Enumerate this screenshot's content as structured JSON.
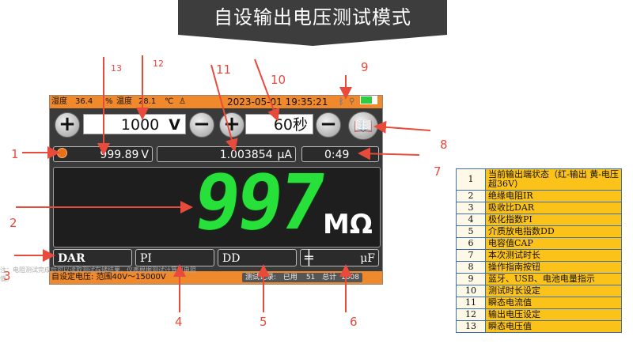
{
  "banner": {
    "title": "自设输出电压测试模式"
  },
  "status": {
    "humidity_label": "湿度",
    "humidity_value": "36.4",
    "humidity_unit": "%",
    "temp_label": "温度",
    "temp_value": "28.1",
    "temp_unit": "℃",
    "datetime": "2023-05-01 19:35:21"
  },
  "voltage_setting": {
    "value": "1000",
    "unit": "V",
    "plus": "+",
    "minus": "−"
  },
  "time_setting": {
    "value": "60秒",
    "plus": "+",
    "minus": "−"
  },
  "readouts": {
    "instant_voltage": "999.89",
    "voltage_unit": "V",
    "instant_current": "1.003854",
    "current_unit": "μA",
    "elapsed": "0:49"
  },
  "main": {
    "value": "997",
    "unit": "MΩ"
  },
  "params": {
    "dar": "DAR",
    "pi": "PI",
    "dd": "DD",
    "cap_symbol": "╪",
    "cap_unit": "μF"
  },
  "bottom": {
    "mode_text": "自设定电压: 范围40V～15000V",
    "record_label": "测试记录:",
    "used_label": "已用",
    "used_value": "51",
    "total_label": "总计",
    "total_value": "1008"
  },
  "callouts": [
    "1",
    "2",
    "3",
    "4",
    "5",
    "6",
    "7",
    "8",
    "9",
    "10",
    "11",
    "12",
    "13"
  ],
  "legend": [
    {
      "num": "1",
      "text": "当前输出端状态（红-输出 黄-电压超36V）"
    },
    {
      "num": "2",
      "text": "绝缘电阻IR"
    },
    {
      "num": "3",
      "text": "吸收比DAR"
    },
    {
      "num": "4",
      "text": "极化指数PI"
    },
    {
      "num": "5",
      "text": "介质放电指数DD"
    },
    {
      "num": "6",
      "text": "电容值CAP"
    },
    {
      "num": "7",
      "text": "本次测试时长"
    },
    {
      "num": "8",
      "text": "操作指南按钮"
    },
    {
      "num": "9",
      "text": "蓝牙、USB、电池电量指示"
    },
    {
      "num": "10",
      "text": "测试时长设定"
    },
    {
      "num": "11",
      "text": "瞬态电流值"
    },
    {
      "num": "12",
      "text": "输出电压设定"
    },
    {
      "num": "13",
      "text": "瞬态电压值"
    }
  ],
  "note": "注：电阻测试完成后可以读取测试存储结果，仪表根据测试计算出电阻值。",
  "colors": {
    "status_bar": "#f0892b",
    "digit_green": "#27e03a",
    "callout_red": "#e84b3c",
    "legend_bg": "#fbc21a"
  }
}
